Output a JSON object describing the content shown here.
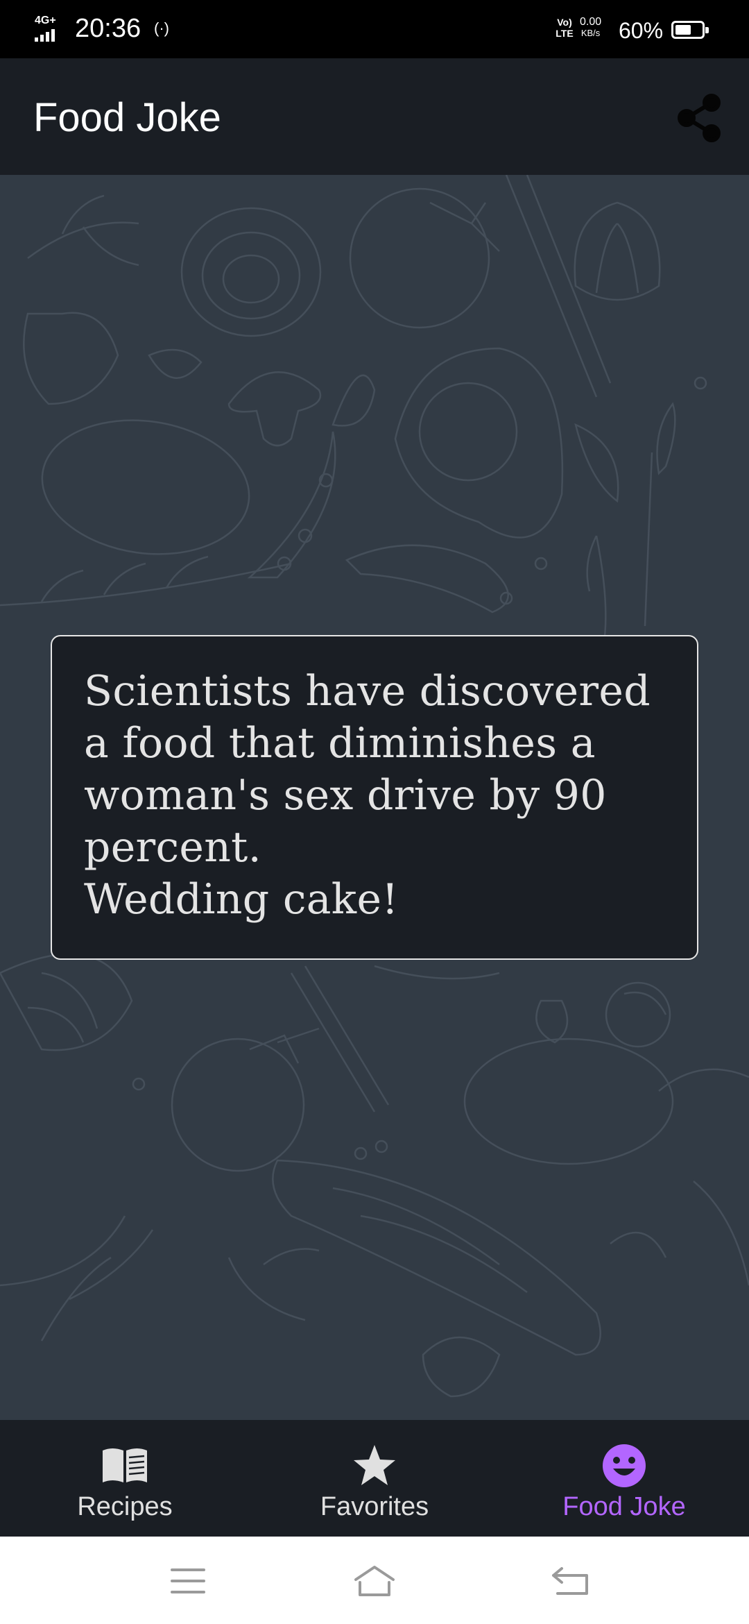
{
  "status_bar": {
    "network_label": "4G+",
    "time": "20:36",
    "hotspot_glyph": "(·)",
    "volte_label": "Vo) LTE",
    "speed_value": "0.00",
    "speed_unit": "KB/s",
    "battery_percent": "60%",
    "battery_level": 0.6,
    "icons": [
      "signal-icon",
      "hotspot-icon",
      "volte-icon",
      "battery-icon"
    ]
  },
  "app_bar": {
    "title": "Food Joke",
    "share_icon": "share-icon"
  },
  "joke": {
    "text": "Scientists have discovered\na food that diminishes a\nwoman's sex drive by 90\npercent.\n Wedding cake!"
  },
  "bottom_nav": {
    "items": [
      {
        "label": "Recipes",
        "icon": "book-icon",
        "active": false
      },
      {
        "label": "Favorites",
        "icon": "star-icon",
        "active": false
      },
      {
        "label": "Food Joke",
        "icon": "smiley-icon",
        "active": true
      }
    ],
    "active_color": "#b366ff",
    "inactive_color": "#e0e0e0"
  },
  "system_nav": {
    "buttons": [
      "menu-icon",
      "home-icon",
      "back-icon"
    ]
  },
  "colors": {
    "app_bar_bg": "#1a1e24",
    "content_bg": "#323b45",
    "card_bg": "#1a1e24",
    "card_border": "#e6e6e6",
    "text": "#e4e4e4"
  }
}
